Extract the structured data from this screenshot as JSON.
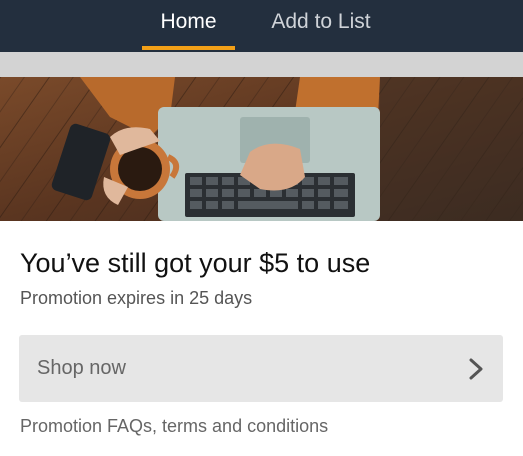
{
  "nav": {
    "tabs": [
      {
        "label": "Home",
        "active": true
      },
      {
        "label": "Add to List",
        "active": false
      }
    ],
    "accent_color": "#f3a017",
    "background_color": "#232f3e"
  },
  "hero": {
    "image_icon": "laptop-coffee-photo"
  },
  "promo": {
    "headline": "You’ve still got your $5 to use",
    "expiry": "Promotion expires in 25 days",
    "shop_button_label": "Shop now",
    "shop_button_icon": "chevron-right-icon",
    "terms_link": "Promotion FAQs, terms and conditions"
  }
}
